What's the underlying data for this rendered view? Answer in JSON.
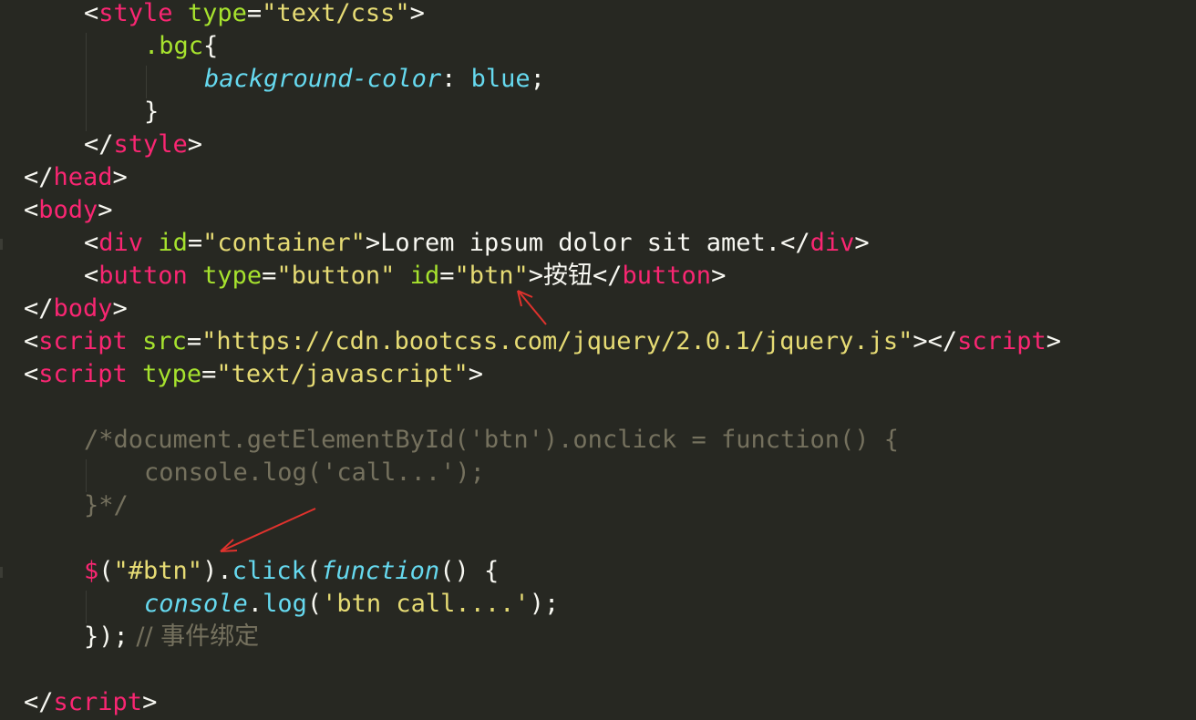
{
  "code": {
    "l1": {
      "open": "<",
      "tag": "style",
      "attr": "type",
      "eq": "=",
      "val": "\"text/css\"",
      "close": ">"
    },
    "l2": {
      "selector": ".bgc",
      "brace": "{"
    },
    "l3": {
      "prop": "background-color",
      "colon": ": ",
      "value": "blue",
      "semi": ";"
    },
    "l4": {
      "brace": "}"
    },
    "l5": {
      "open": "</",
      "tag": "style",
      "close": ">"
    },
    "l6": {
      "open": "</",
      "tag": "head",
      "close": ">"
    },
    "l7": {
      "open": "<",
      "tag": "body",
      "close": ">"
    },
    "l8": {
      "open": "<",
      "tag": "div",
      "attr": "id",
      "eq": "=",
      "val": "\"container\"",
      "gt": ">",
      "text": "Lorem ipsum dolor sit amet.",
      "endopen": "</",
      "endtag": "div",
      "endclose": ">"
    },
    "l9": {
      "open": "<",
      "tag": "button",
      "attr1": "type",
      "eq1": "=",
      "val1": "\"button\"",
      "attr2": "id",
      "eq2": "=",
      "val2": "\"btn\"",
      "gt": ">",
      "text": "按钮",
      "endopen": "</",
      "endtag": "button",
      "endclose": ">"
    },
    "l10": {
      "open": "</",
      "tag": "body",
      "close": ">"
    },
    "l11": {
      "open": "<",
      "tag": "script",
      "attr": "src",
      "eq": "=",
      "val": "\"https://cdn.bootcss.com/jquery/2.0.1/jquery.js\"",
      "gt": ">",
      "endopen": "</",
      "endtag": "script",
      "endclose": ">"
    },
    "l12": {
      "open": "<",
      "tag": "script",
      "attr": "type",
      "eq": "=",
      "val": "\"text/javascript\"",
      "close": ">"
    },
    "l14": {
      "comment": "/*document.getElementById('btn').onclick = function() {"
    },
    "l15": {
      "comment": "console.log('call...');"
    },
    "l16": {
      "comment": "}*/"
    },
    "l18": {
      "dollar": "$",
      "p1": "(",
      "sel": "\"#btn\"",
      "p2": ").",
      "fn": "click",
      "p3": "(",
      "kw": "function",
      "p4": "() {"
    },
    "l19": {
      "obj": "console",
      "dot": ".",
      "fn": "log",
      "p1": "(",
      "str": "'btn call....'",
      "p2": ");"
    },
    "l20": {
      "code": "});",
      "comment": " // 事件绑定"
    },
    "l22": {
      "open": "</",
      "tag": "script",
      "close": ">"
    }
  },
  "colors": {
    "background": "#272822",
    "tag": "#f92672",
    "attribute": "#a6e22e",
    "string": "#e6db74",
    "keyword": "#66d9ef",
    "comment": "#75715e",
    "annotation_arrow": "#e0322d"
  }
}
